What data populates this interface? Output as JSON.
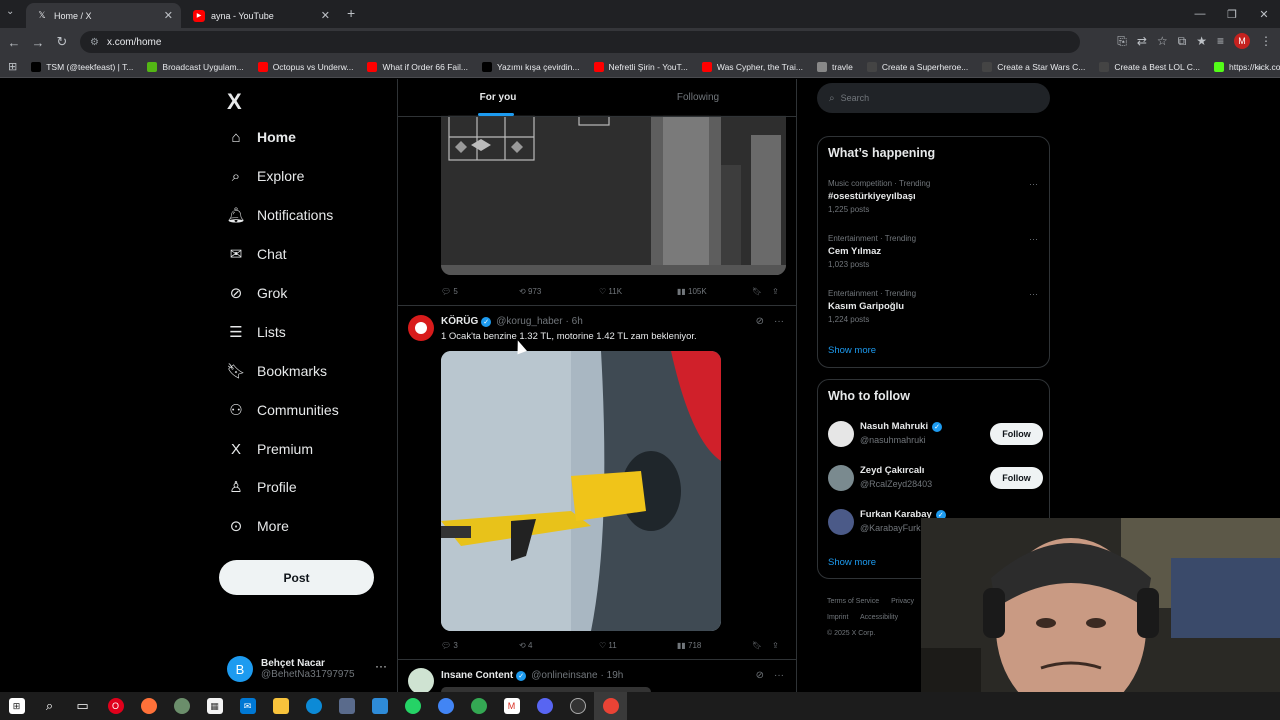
{
  "browser": {
    "tabs": [
      {
        "title": "Home / X",
        "icon": "x-logo-icon"
      },
      {
        "title": "ayna - YouTube",
        "icon": "youtube-icon"
      }
    ],
    "new_tab": "+",
    "address": "x.com/home",
    "profile_initial": "M",
    "bookmarks": [
      {
        "label": "TSM (@teekfeast) | T...",
        "color": "#000000"
      },
      {
        "label": "Broadcast Uygulam...",
        "color": "#53b614"
      },
      {
        "label": "Octopus vs Underw...",
        "color": "#ff0000"
      },
      {
        "label": "What if Order 66 Fail...",
        "color": "#ff0000"
      },
      {
        "label": "Yazımı kışa çevirdin...",
        "color": "#000000"
      },
      {
        "label": "Nefretli Şirin - YouT...",
        "color": "#ff0000"
      },
      {
        "label": "Was Cypher, the Trai...",
        "color": "#ff0000"
      },
      {
        "label": "travle",
        "color": "#888888"
      },
      {
        "label": "Create a Superheroe...",
        "color": "#444444"
      },
      {
        "label": "Create a Star Wars C...",
        "color": "#444444"
      },
      {
        "label": "Create a Best LOL C...",
        "color": "#444444"
      },
      {
        "label": "https://kick.com/m...",
        "color": "#53fc18"
      }
    ]
  },
  "sidebar": {
    "logo": "X",
    "items": [
      {
        "label": "Home",
        "icon": "home-icon",
        "glyph": "⌂"
      },
      {
        "label": "Explore",
        "icon": "search-icon",
        "glyph": "⌕"
      },
      {
        "label": "Notifications",
        "icon": "bell-icon",
        "glyph": "🔔︎"
      },
      {
        "label": "Chat",
        "icon": "mail-icon",
        "glyph": "✉"
      },
      {
        "label": "Grok",
        "icon": "grok-icon",
        "glyph": "⊘"
      },
      {
        "label": "Lists",
        "icon": "list-icon",
        "glyph": "☰"
      },
      {
        "label": "Bookmarks",
        "icon": "bookmark-icon",
        "glyph": "🔖︎"
      },
      {
        "label": "Communities",
        "icon": "communities-icon",
        "glyph": "⚇"
      },
      {
        "label": "Premium",
        "icon": "x-premium-icon",
        "glyph": "X"
      },
      {
        "label": "Profile",
        "icon": "profile-icon",
        "glyph": "♙"
      },
      {
        "label": "More",
        "icon": "more-circle-icon",
        "glyph": "⊙"
      }
    ],
    "post_label": "Post",
    "account": {
      "initial": "B",
      "name": "Behçet Nacar",
      "handle": "@BehetNa31797975"
    }
  },
  "feed": {
    "tabs": [
      "For you",
      "Following"
    ],
    "tweet1_actions": {
      "replies": "5",
      "reposts": "973",
      "likes": "11K",
      "views": "105K"
    },
    "tweet2": {
      "name": "KÖRÜG",
      "handle": "@korug_haber",
      "time": "· 6h",
      "text": "1 Ocak'ta benzine 1.32 TL, motorine 1.42 TL zam bekleniyor.",
      "actions": {
        "replies": "3",
        "reposts": "4",
        "likes": "11",
        "views": "718"
      }
    },
    "tweet3": {
      "name": "Insane Content",
      "handle": "@onlineinsane",
      "time": "· 19h"
    }
  },
  "right": {
    "search_placeholder": "Search",
    "happening_title": "What’s happening",
    "trends": [
      {
        "category": "Music competition · Trending",
        "name": "#osestürkiyeyılbaşı",
        "posts": "1,225 posts"
      },
      {
        "category": "Entertainment · Trending",
        "name": "Cem Yılmaz",
        "posts": "1,023 posts"
      },
      {
        "category": "Entertainment · Trending",
        "name": "Kasım Garipoğlu",
        "posts": "1,224 posts"
      }
    ],
    "show_more": "Show more",
    "wtf_title": "Who to follow",
    "follow_label": "Follow",
    "wtf": [
      {
        "name": "Nasuh Mahruki",
        "handle": "@nasuhmahruki"
      },
      {
        "name": "Zeyd Çakırcalı",
        "handle": "@RcalZeyd28403"
      },
      {
        "name": "Furkan Karabay",
        "handle": "@KarabayFurk"
      }
    ],
    "footer": [
      "Terms of Service",
      "Privacy",
      "Imprint",
      "Accessibility",
      "© 2025 X Corp."
    ]
  }
}
